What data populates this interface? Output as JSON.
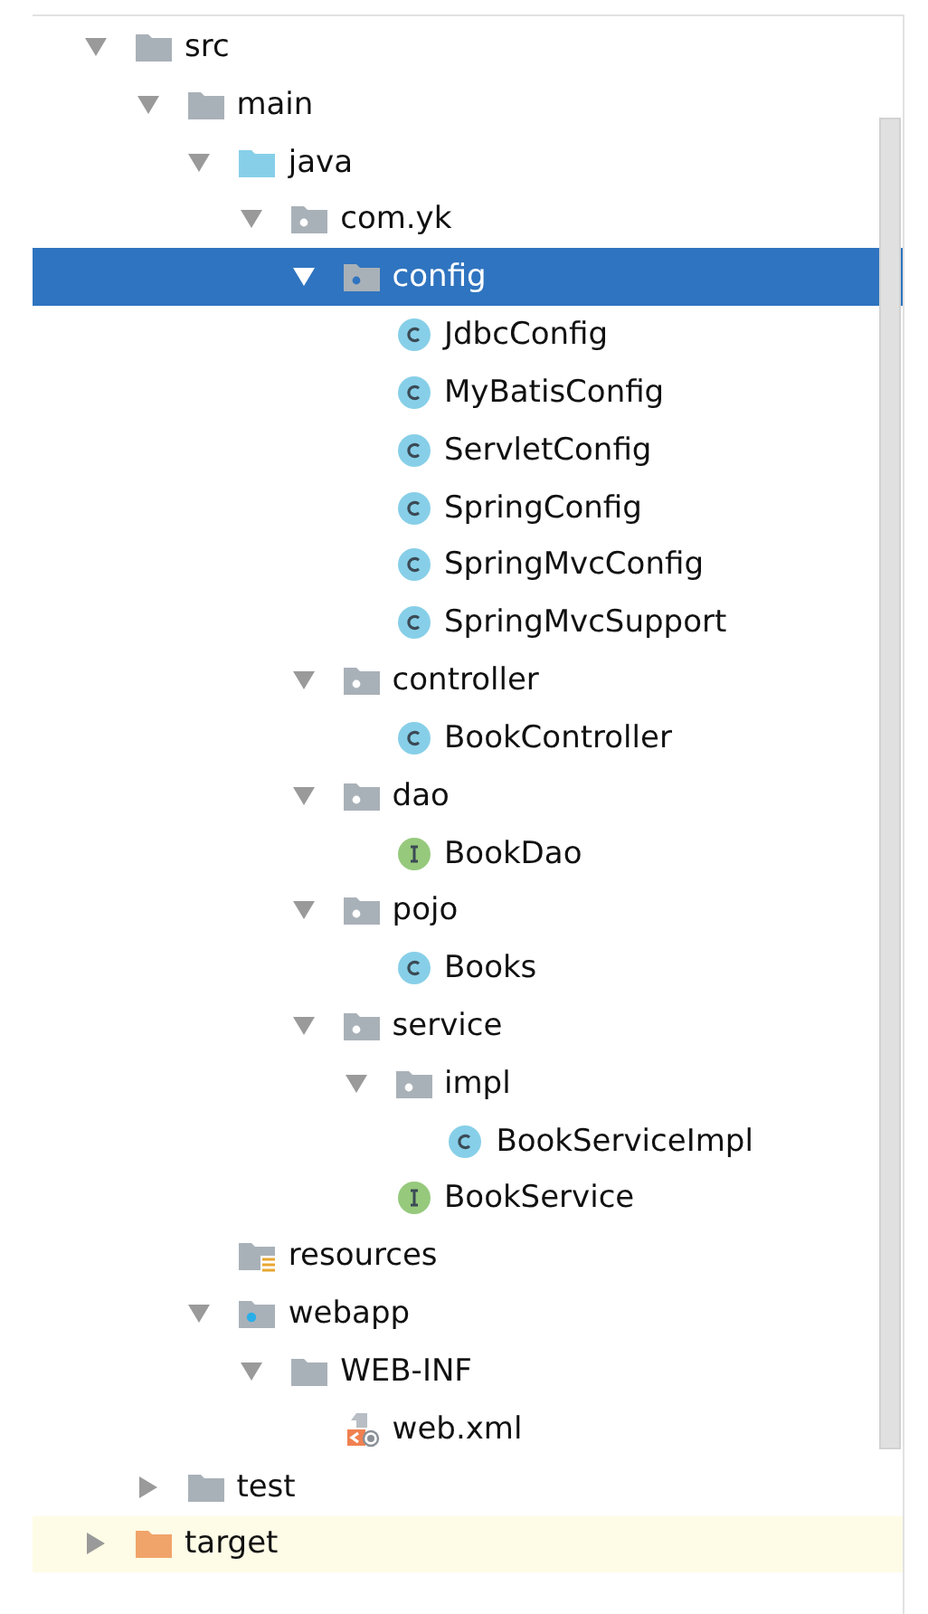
{
  "tree": [
    {
      "label": "src",
      "kind": "folder",
      "expanded": true,
      "selected": false,
      "highlighted": false,
      "children": [
        {
          "label": "main",
          "kind": "folder",
          "expanded": true,
          "selected": false,
          "highlighted": false,
          "children": [
            {
              "label": "java",
              "kind": "source-root",
              "expanded": true,
              "selected": false,
              "highlighted": false,
              "children": [
                {
                  "label": "com.yk",
                  "kind": "package",
                  "expanded": true,
                  "selected": false,
                  "highlighted": false,
                  "children": [
                    {
                      "label": "config",
                      "kind": "package",
                      "expanded": true,
                      "selected": true,
                      "highlighted": false,
                      "children": [
                        {
                          "label": "JdbcConfig",
                          "kind": "class",
                          "selected": false,
                          "highlighted": false
                        },
                        {
                          "label": "MyBatisConfig",
                          "kind": "class",
                          "selected": false,
                          "highlighted": false
                        },
                        {
                          "label": "ServletConfig",
                          "kind": "class",
                          "selected": false,
                          "highlighted": false
                        },
                        {
                          "label": "SpringConfig",
                          "kind": "class",
                          "selected": false,
                          "highlighted": false
                        },
                        {
                          "label": "SpringMvcConfig",
                          "kind": "class",
                          "selected": false,
                          "highlighted": false
                        },
                        {
                          "label": "SpringMvcSupport",
                          "kind": "class",
                          "selected": false,
                          "highlighted": false
                        }
                      ]
                    },
                    {
                      "label": "controller",
                      "kind": "package",
                      "expanded": true,
                      "selected": false,
                      "highlighted": false,
                      "children": [
                        {
                          "label": "BookController",
                          "kind": "class",
                          "selected": false,
                          "highlighted": false
                        }
                      ]
                    },
                    {
                      "label": "dao",
                      "kind": "package",
                      "expanded": true,
                      "selected": false,
                      "highlighted": false,
                      "children": [
                        {
                          "label": "BookDao",
                          "kind": "interface",
                          "selected": false,
                          "highlighted": false
                        }
                      ]
                    },
                    {
                      "label": "pojo",
                      "kind": "package",
                      "expanded": true,
                      "selected": false,
                      "highlighted": false,
                      "children": [
                        {
                          "label": "Books",
                          "kind": "class",
                          "selected": false,
                          "highlighted": false
                        }
                      ]
                    },
                    {
                      "label": "service",
                      "kind": "package",
                      "expanded": true,
                      "selected": false,
                      "highlighted": false,
                      "children": [
                        {
                          "label": "impl",
                          "kind": "package",
                          "expanded": true,
                          "selected": false,
                          "highlighted": false,
                          "children": [
                            {
                              "label": "BookServiceImpl",
                              "kind": "class",
                              "selected": false,
                              "highlighted": false
                            }
                          ]
                        },
                        {
                          "label": "BookService",
                          "kind": "interface",
                          "selected": false,
                          "highlighted": false
                        }
                      ]
                    }
                  ]
                }
              ]
            },
            {
              "label": "resources",
              "kind": "resources",
              "selected": false,
              "highlighted": false
            },
            {
              "label": "webapp",
              "kind": "webapp",
              "expanded": true,
              "selected": false,
              "highlighted": false,
              "children": [
                {
                  "label": "WEB-INF",
                  "kind": "folder",
                  "expanded": true,
                  "selected": false,
                  "highlighted": false,
                  "children": [
                    {
                      "label": "web.xml",
                      "kind": "xml",
                      "selected": false,
                      "highlighted": false
                    }
                  ]
                }
              ]
            }
          ]
        },
        {
          "label": "test",
          "kind": "folder",
          "expanded": false,
          "selected": false,
          "highlighted": false
        }
      ]
    },
    {
      "label": "target",
      "kind": "excluded-folder",
      "expanded": false,
      "selected": false,
      "highlighted": true
    }
  ]
}
